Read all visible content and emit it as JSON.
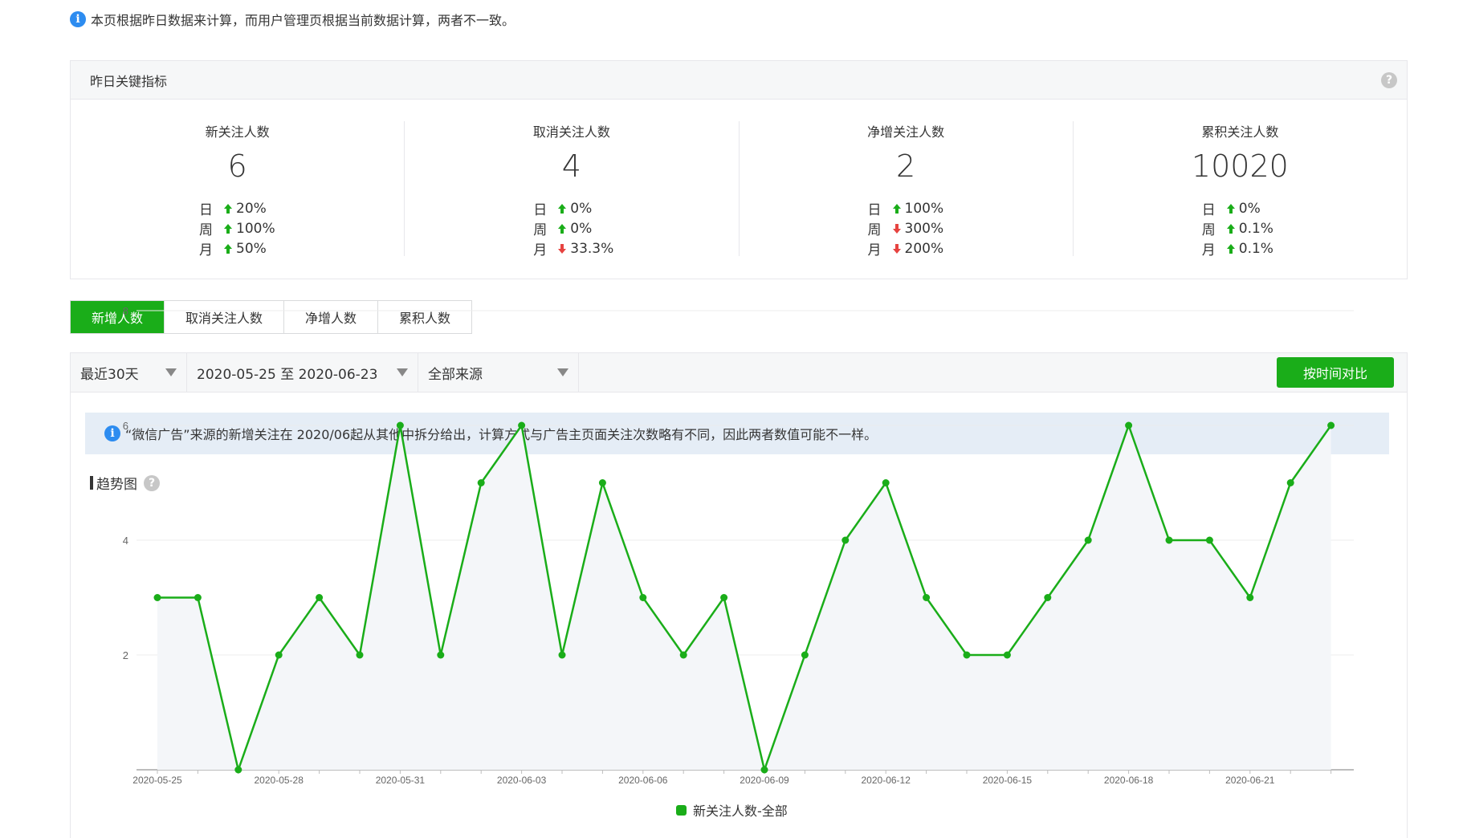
{
  "notice": "本页根据昨日数据来计算，而用户管理页根据当前数据计算，两者不一致。",
  "kpi_panel": {
    "title": "昨日关键指标",
    "cards": [
      {
        "title": "新关注人数",
        "value": "6",
        "rows": [
          {
            "period": "日",
            "dir": "up",
            "change": "20%"
          },
          {
            "period": "周",
            "dir": "up",
            "change": "100%"
          },
          {
            "period": "月",
            "dir": "up",
            "change": "50%"
          }
        ]
      },
      {
        "title": "取消关注人数",
        "value": "4",
        "rows": [
          {
            "period": "日",
            "dir": "up",
            "change": "0%"
          },
          {
            "period": "周",
            "dir": "up",
            "change": "0%"
          },
          {
            "period": "月",
            "dir": "down",
            "change": "33.3%"
          }
        ]
      },
      {
        "title": "净增关注人数",
        "value": "2",
        "rows": [
          {
            "period": "日",
            "dir": "up",
            "change": "100%"
          },
          {
            "period": "周",
            "dir": "down",
            "change": "300%"
          },
          {
            "period": "月",
            "dir": "down",
            "change": "200%"
          }
        ]
      },
      {
        "title": "累积关注人数",
        "value": "10020",
        "rows": [
          {
            "period": "日",
            "dir": "up",
            "change": "0%"
          },
          {
            "period": "周",
            "dir": "up",
            "change": "0.1%"
          },
          {
            "period": "月",
            "dir": "up",
            "change": "0.1%"
          }
        ]
      }
    ]
  },
  "tabs": [
    {
      "label": "新增人数",
      "active": true
    },
    {
      "label": "取消关注人数",
      "active": false
    },
    {
      "label": "净增人数",
      "active": false
    },
    {
      "label": "累积人数",
      "active": false
    }
  ],
  "filters": {
    "range": "最近30天",
    "dates": "2020-05-25 至 2020-06-23",
    "source": "全部来源",
    "compare_button": "按时间对比"
  },
  "tip": "“微信广告”来源的新增关注在 2020/06起从其他中拆分给出，计算方式与广告主页面关注次数略有不同，因此两者数值可能不一样。",
  "trend_title": "趋势图",
  "colors": {
    "accent": "#1aad19",
    "up": "#1aad19",
    "down": "#e64340",
    "info": "#2d8cf0"
  },
  "chart_data": {
    "type": "area",
    "x": [
      "2020-05-25",
      "2020-05-26",
      "2020-05-27",
      "2020-05-28",
      "2020-05-29",
      "2020-05-30",
      "2020-05-31",
      "2020-06-01",
      "2020-06-02",
      "2020-06-03",
      "2020-06-04",
      "2020-06-05",
      "2020-06-06",
      "2020-06-07",
      "2020-06-08",
      "2020-06-09",
      "2020-06-10",
      "2020-06-11",
      "2020-06-12",
      "2020-06-13",
      "2020-06-14",
      "2020-06-15",
      "2020-06-16",
      "2020-06-17",
      "2020-06-18",
      "2020-06-19",
      "2020-06-20",
      "2020-06-21",
      "2020-06-22",
      "2020-06-23"
    ],
    "xtick_labels": [
      "2020-05-25",
      "2020-05-28",
      "2020-05-31",
      "2020-06-03",
      "2020-06-06",
      "2020-06-09",
      "2020-06-12",
      "2020-06-15",
      "2020-06-18",
      "2020-06-21"
    ],
    "series": [
      {
        "name": "新关注人数-全部",
        "values": [
          3,
          3,
          0,
          2,
          3,
          2,
          6,
          2,
          5,
          6,
          2,
          5,
          3,
          2,
          3,
          0,
          2,
          4,
          5,
          3,
          2,
          2,
          3,
          4,
          6,
          4,
          4,
          3,
          5,
          6
        ]
      }
    ],
    "ylim": [
      0,
      8
    ],
    "yticks": [
      2,
      4,
      6,
      8
    ],
    "grid": true,
    "legend": "bottom-center"
  }
}
